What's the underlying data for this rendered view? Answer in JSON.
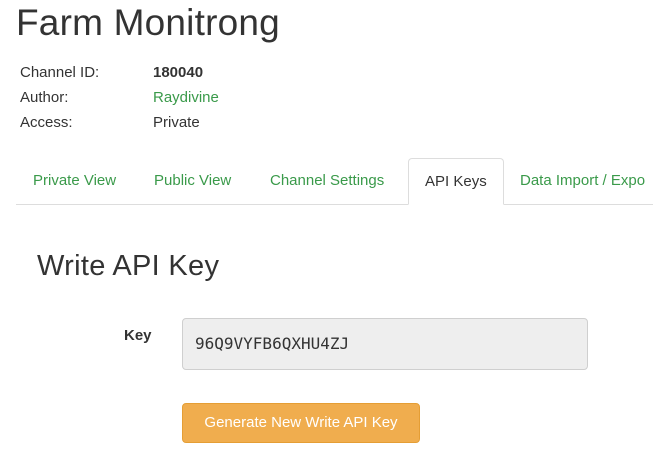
{
  "channel": {
    "title": "Farm Monitrong",
    "meta": [
      {
        "label": "Channel ID:",
        "value": "180040"
      },
      {
        "label": "Author:",
        "value": "Raydivine"
      },
      {
        "label": "Access:",
        "value": "Private"
      }
    ]
  },
  "tabs": [
    {
      "label": "Private View",
      "active": false
    },
    {
      "label": "Public View",
      "active": false
    },
    {
      "label": "Channel Settings",
      "active": false
    },
    {
      "label": "API Keys",
      "active": true
    },
    {
      "label": "Data Import / Expo",
      "active": false
    }
  ],
  "write_key": {
    "section_title": "Write API Key",
    "key_label": "Key",
    "key_value": "96Q9VYFB6QXHU4ZJ",
    "generate_button": "Generate New Write API Key"
  },
  "colors": {
    "link": "#3a9a4a",
    "button": "#f0ad4e"
  }
}
